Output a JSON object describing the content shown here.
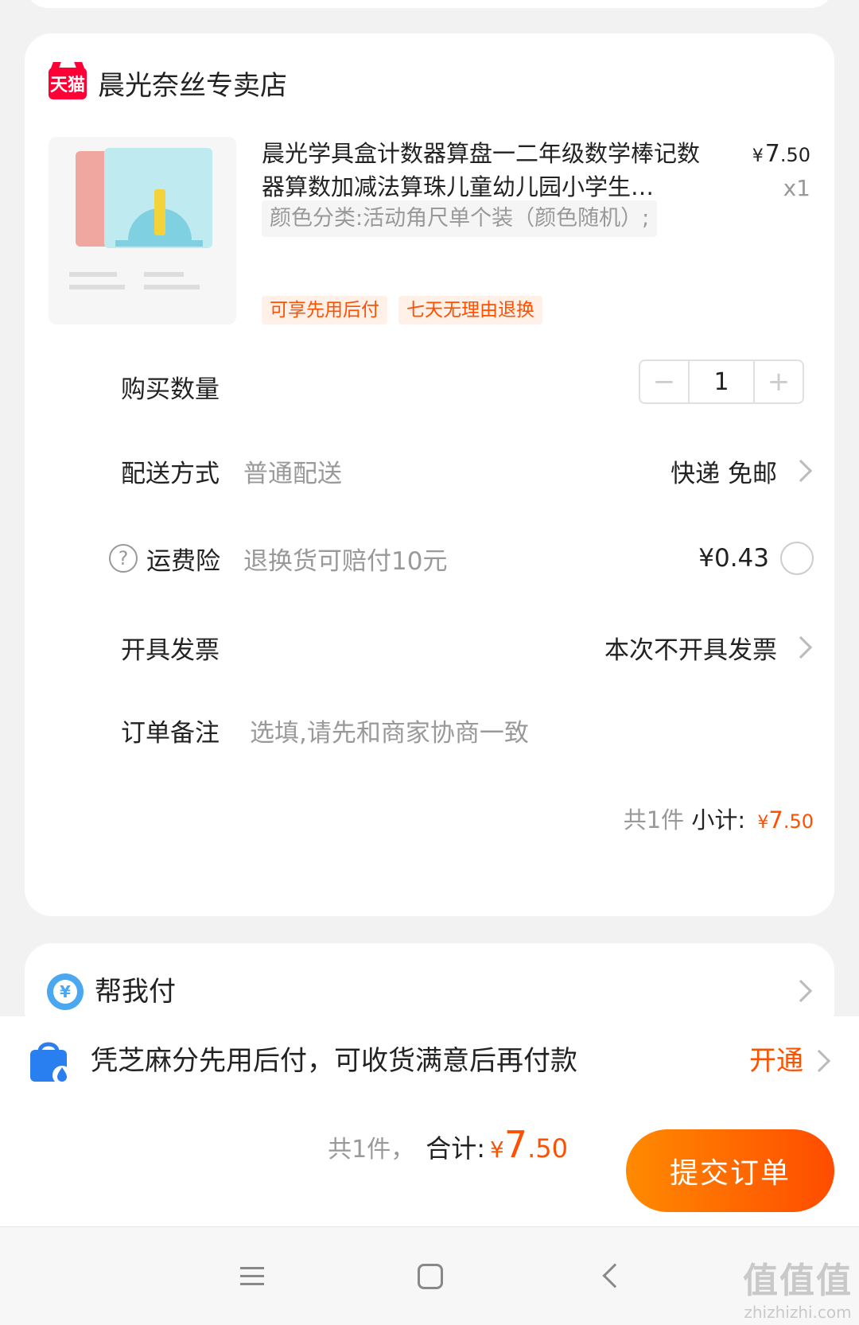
{
  "store": {
    "badge": "天猫",
    "name": "晨光奈丝专卖店"
  },
  "product": {
    "title": "晨光学具盒计数器算盘一二年级数学棒记数器算数加减法算珠儿童幼儿园小学生…",
    "price_symbol": "¥",
    "price_int": "7",
    "price_dec": ".50",
    "quantity": "x1",
    "sku": "颜色分类:活动角尺单个装（颜色随机）;",
    "tags": [
      "可享先用后付",
      "七天无理由退换"
    ]
  },
  "rows": {
    "quantity": {
      "label": "购买数量",
      "minus": "−",
      "value": "1",
      "plus": "+"
    },
    "delivery": {
      "label": "配送方式",
      "sub": "普通配送",
      "value": "快递 免邮"
    },
    "insurance": {
      "help": "?",
      "label": "运费险",
      "sub": "退换货可赔付10元",
      "value": "¥0.43"
    },
    "invoice": {
      "label": "开具发票",
      "value": "本次不开具发票"
    },
    "note": {
      "label": "订单备注",
      "placeholder": "选填,请先和商家协商一致"
    }
  },
  "subtotal": {
    "count": "共1件",
    "label": "小计:",
    "symbol": "¥",
    "int": "7",
    "dec": ".50"
  },
  "help_pay": {
    "icon_text": "¥",
    "label": "帮我付"
  },
  "zhima": {
    "text": "凭芝麻分先用后付，可收货满意后再付款",
    "action": "开通"
  },
  "footer": {
    "count": "共1件，",
    "label": "合计:",
    "symbol": "¥",
    "int": "7",
    "dec": ".50",
    "submit": "提交订单"
  },
  "watermark": {
    "big": "值值值",
    "small": "zhizhizhi.com"
  },
  "colors": {
    "accent": "#ff5000",
    "tmall": "#ff0036",
    "help_pay_icon": "#4aa8f0"
  },
  "icons": [
    "tmall-logo-icon",
    "help-circle-icon",
    "radio-icon",
    "chevron-right-icon",
    "help-pay-icon",
    "zhima-bag-icon",
    "menu-icon",
    "home-icon",
    "back-icon"
  ]
}
